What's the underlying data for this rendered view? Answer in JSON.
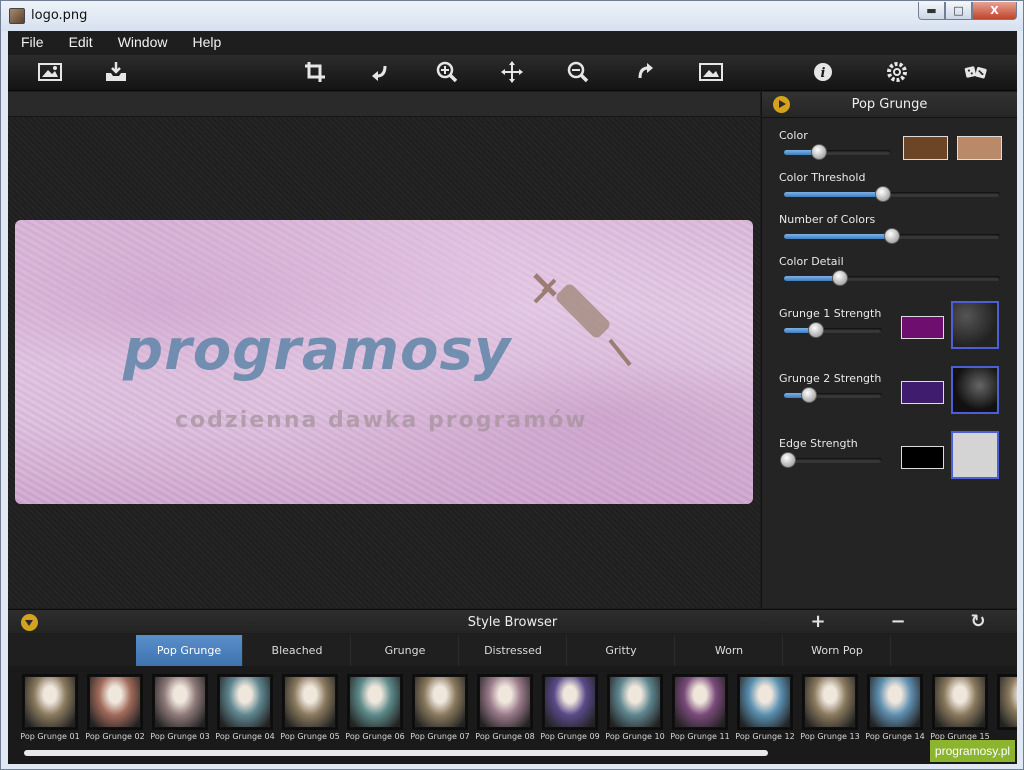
{
  "window": {
    "title": "logo.png",
    "minimize": "▬",
    "maximize": "□",
    "close": "X"
  },
  "menu": [
    "File",
    "Edit",
    "Window",
    "Help"
  ],
  "toolbar": {
    "tools": [
      "open-image-icon",
      "save-icon",
      "crop-icon",
      "rotate-left-icon",
      "zoom-in-icon",
      "move-icon",
      "zoom-out-icon",
      "rotate-right-icon",
      "fit-image-icon",
      "info-icon",
      "settings-icon",
      "random-dice-icon"
    ]
  },
  "canvas": {
    "logo_text": "programosy",
    "slogan_text": "codzienna dawka programów"
  },
  "panel": {
    "title": "Pop Grunge",
    "params": [
      {
        "label": "Color",
        "value": 0.33
      },
      {
        "label": "Color Threshold",
        "value": 0.46
      },
      {
        "label": "Number of Colors",
        "value": 0.5
      },
      {
        "label": "Color Detail",
        "value": 0.26
      },
      {
        "label": "Grunge 1 Strength",
        "value": 0.33
      },
      {
        "label": "Grunge 2 Strength",
        "value": 0.25
      },
      {
        "label": "Edge Strength",
        "value": 0.04
      }
    ],
    "colors": {
      "color_1": "#6b4526",
      "color_2": "#b9896a",
      "grunge1": "#6e0e6e",
      "grunge2": "#3f1c6e",
      "edge": "#000000"
    }
  },
  "style_browser": {
    "title": "Style Browser",
    "add": "+",
    "remove": "−",
    "refresh": "↻",
    "tabs": [
      "Pop Grunge",
      "Bleached",
      "Grunge",
      "Distressed",
      "Gritty",
      "Worn",
      "Worn Pop"
    ],
    "active_tab": "Pop Grunge",
    "thumbnails": [
      "Pop Grunge 01",
      "Pop Grunge 02",
      "Pop Grunge 03",
      "Pop Grunge 04",
      "Pop Grunge 05",
      "Pop Grunge 06",
      "Pop Grunge 07",
      "Pop Grunge 08",
      "Pop Grunge 09",
      "Pop Grunge 10",
      "Pop Grunge 11",
      "Pop Grunge 12",
      "Pop Grunge 13",
      "Pop Grunge 14",
      "Pop Grunge 15",
      "Pop"
    ]
  },
  "watermark": "programosy.pl"
}
